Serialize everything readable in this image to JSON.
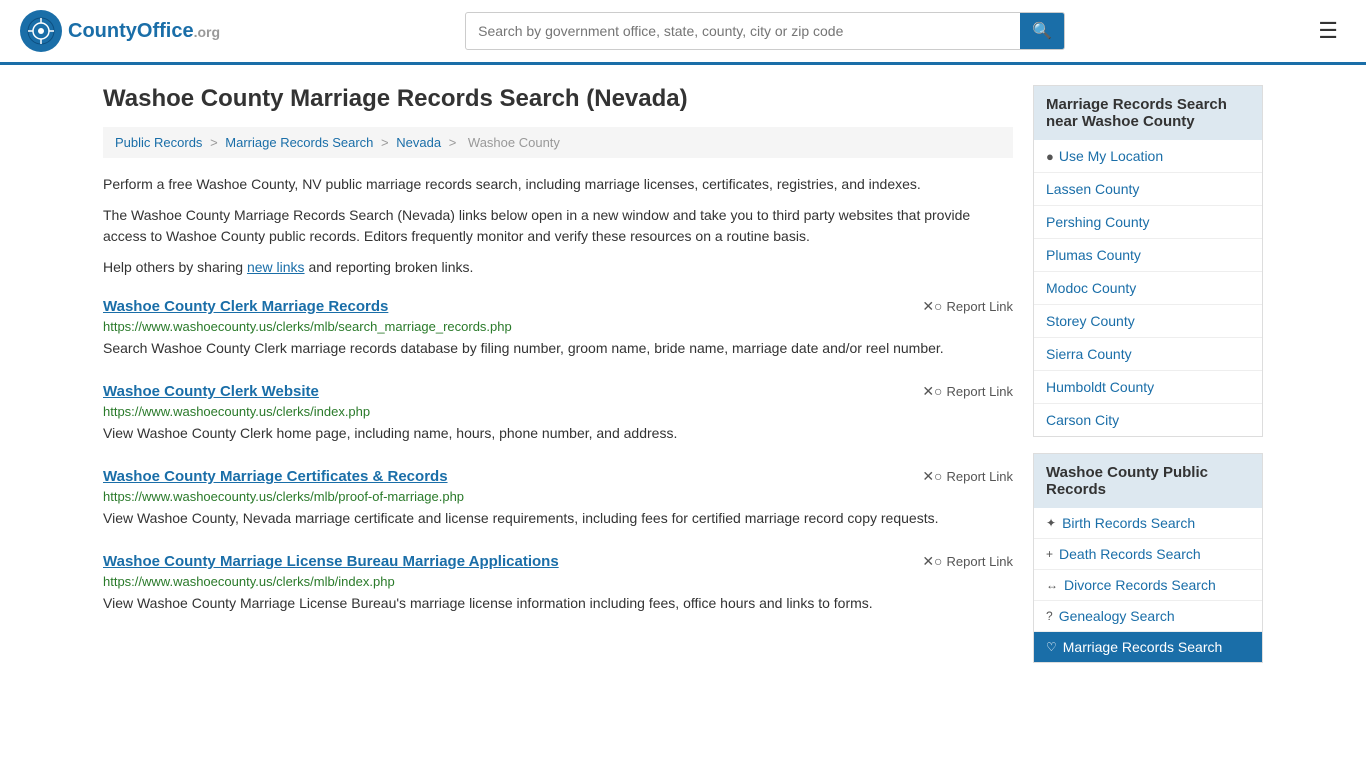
{
  "header": {
    "logo_text": "County",
    "logo_org": "Office",
    "logo_tld": ".org",
    "search_placeholder": "Search by government office, state, county, city or zip code"
  },
  "page": {
    "title": "Washoe County Marriage Records Search (Nevada)"
  },
  "breadcrumb": {
    "items": [
      "Public Records",
      "Marriage Records Search",
      "Nevada",
      "Washoe County"
    ]
  },
  "intro": {
    "text1": "Perform a free Washoe County, NV public marriage records search, including marriage licenses, certificates, registries, and indexes.",
    "text2": "The Washoe County Marriage Records Search (Nevada) links below open in a new window and take you to third party websites that provide access to Washoe County public records. Editors frequently monitor and verify these resources on a routine basis.",
    "share_pre": "Help others by sharing ",
    "share_link": "new links",
    "share_post": " and reporting broken links."
  },
  "records": [
    {
      "title": "Washoe County Clerk Marriage Records",
      "url": "https://www.washoecounty.us/clerks/mlb/search_marriage_records.php",
      "desc": "Search Washoe County Clerk marriage records database by filing number, groom name, bride name, marriage date and/or reel number.",
      "report_label": "Report Link"
    },
    {
      "title": "Washoe County Clerk Website",
      "url": "https://www.washoecounty.us/clerks/index.php",
      "desc": "View Washoe County Clerk home page, including name, hours, phone number, and address.",
      "report_label": "Report Link"
    },
    {
      "title": "Washoe County Marriage Certificates & Records",
      "url": "https://www.washoecounty.us/clerks/mlb/proof-of-marriage.php",
      "desc": "View Washoe County, Nevada marriage certificate and license requirements, including fees for certified marriage record copy requests.",
      "report_label": "Report Link"
    },
    {
      "title": "Washoe County Marriage License Bureau Marriage Applications",
      "url": "https://www.washoecounty.us/clerks/mlb/index.php",
      "desc": "View Washoe County Marriage License Bureau's marriage license information including fees, office hours and links to forms.",
      "report_label": "Report Link"
    }
  ],
  "sidebar": {
    "nearby_title": "Marriage Records Search near Washoe County",
    "use_location": "Use My Location",
    "nearby_counties": [
      "Lassen County",
      "Pershing County",
      "Plumas County",
      "Modoc County",
      "Storey County",
      "Sierra County",
      "Humboldt County",
      "Carson City"
    ],
    "public_records_title": "Washoe County Public Records",
    "public_records": [
      {
        "icon": "✦",
        "label": "Birth Records Search",
        "active": false
      },
      {
        "icon": "+",
        "label": "Death Records Search",
        "active": false
      },
      {
        "icon": "↔",
        "label": "Divorce Records Search",
        "active": false
      },
      {
        "icon": "?",
        "label": "Genealogy Search",
        "active": false
      },
      {
        "icon": "♡",
        "label": "Marriage Records Search",
        "active": true
      }
    ]
  }
}
